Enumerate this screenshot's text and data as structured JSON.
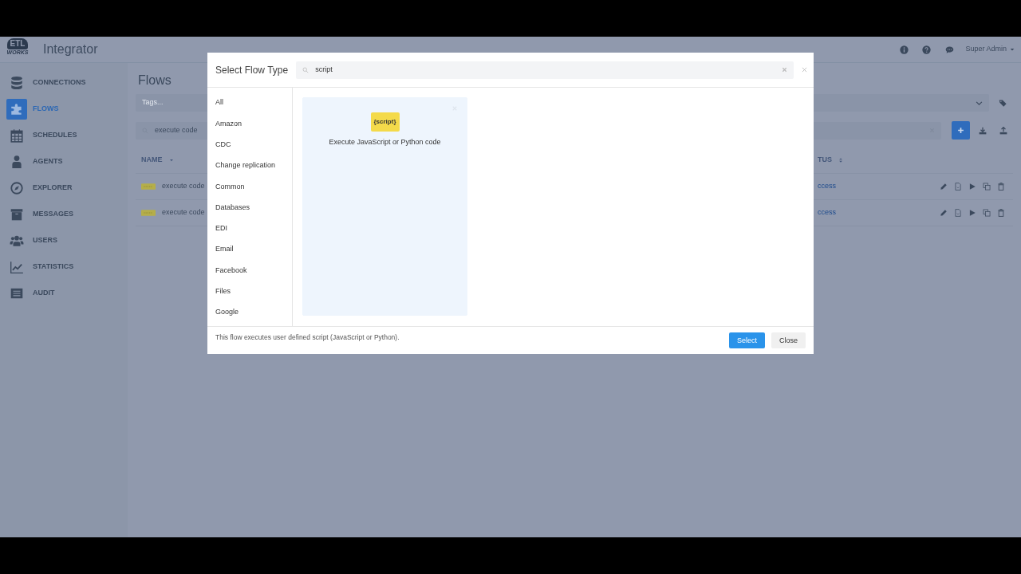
{
  "header": {
    "logo_top": "ETL",
    "logo_bottom": "WORKS",
    "app_name": "Integrator",
    "user": "Super Admin"
  },
  "sidebar": {
    "items": [
      {
        "label": "CONNECTIONS",
        "selected": false
      },
      {
        "label": "FLOWS",
        "selected": true
      },
      {
        "label": "SCHEDULES",
        "selected": false
      },
      {
        "label": "AGENTS",
        "selected": false
      },
      {
        "label": "EXPLORER",
        "selected": false
      },
      {
        "label": "MESSAGES",
        "selected": false
      },
      {
        "label": "USERS",
        "selected": false
      },
      {
        "label": "STATISTICS",
        "selected": false
      },
      {
        "label": "AUDIT",
        "selected": false
      }
    ]
  },
  "page": {
    "title": "Flows",
    "tags": {
      "placeholder": "Tags..."
    },
    "search": {
      "value": "execute code"
    },
    "table": {
      "columns": [
        "NAME",
        "TUS"
      ],
      "rows": [
        {
          "name": "execute code",
          "status": "ccess"
        },
        {
          "name": "execute code",
          "status": "ccess"
        }
      ]
    }
  },
  "modal": {
    "title": "Select Flow Type",
    "search": {
      "value": "script"
    },
    "categories": [
      "All",
      "Amazon",
      "CDC",
      "Change replication",
      "Common",
      "Databases",
      "EDI",
      "Email",
      "Facebook",
      "Files",
      "Google"
    ],
    "results": [
      {
        "icon_text": "{script}",
        "label": "Execute JavaScript or Python code",
        "selected": true
      }
    ],
    "description": "This flow executes user defined script (JavaScript or Python).",
    "buttons": [
      {
        "label": "Select",
        "kind": "primary"
      },
      {
        "label": "Close",
        "kind": "secondary"
      }
    ]
  }
}
